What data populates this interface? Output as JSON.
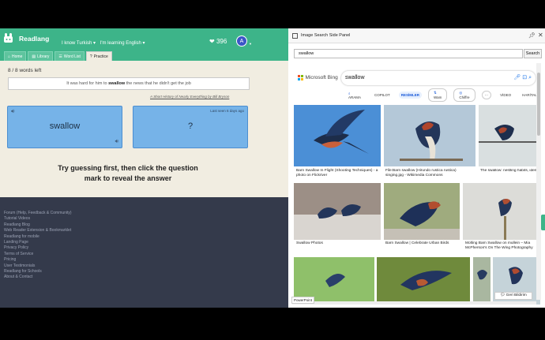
{
  "readlang": {
    "brand": "Readlang",
    "lang_known": "I know Turkish ▾",
    "lang_learning": "I'm learning English ▾",
    "points": "396",
    "avatar_letter": "A",
    "tabs": [
      {
        "label": "Home",
        "icon": "home-icon"
      },
      {
        "label": "Library",
        "icon": "library-icon"
      },
      {
        "label": "Word List",
        "icon": "list-icon"
      },
      {
        "label": "Practice",
        "icon": "question-icon"
      }
    ],
    "words_left": "8 / 8 words left",
    "sentence_before": "It was hard for him to ",
    "sentence_word": "swallow",
    "sentence_after": " the news that he didn't get the job",
    "source": "A Short History of Nearly Everything by Bill Bryson",
    "card_front_word": "swallow",
    "card_back_word": "?",
    "last_seen": "Last seen 6 days ago",
    "hint_line1": "Try guessing first, then click the question",
    "hint_line2": "mark to reveal the answer",
    "footer_links": [
      "Forum (Help, Feedback & Community)",
      "Tutorial Videos",
      "Readlang Blog",
      "Web Reader Extension & Bookmarklet",
      "Readlang for mobile",
      "Landing Page",
      "Privacy Policy",
      "Terms of Service",
      "Pricing",
      "User Testimonials",
      "Readlang for Schools",
      "About & Contact"
    ]
  },
  "side_panel": {
    "title": "Image Search Side Panel",
    "search_value": "swallow",
    "search_button": "Search",
    "bing_brand": "Microsoft Bing",
    "bing_query": "swallow",
    "bing_tabs": [
      "ARAMA",
      "COPILOT",
      "RESİMLER",
      "Wam",
      "Chiffre",
      "···",
      "VİDEO",
      "HARİTALAR"
    ],
    "results": [
      {
        "caption": "Barn Swallow In Flight (Shooting Techniques) - a photo on Flickriver"
      },
      {
        "caption": "File:Barn swallow (Hirundo rustica rustica) singing.jpg - Wikimedia Commons"
      },
      {
        "caption": "The swallow: nestling habits, identification, migration - Saga"
      },
      {
        "caption": "Swallow Photos"
      },
      {
        "caption": "Barn Swallow | Celebrate Urban Birds"
      },
      {
        "caption": "Molting Barn Swallow on mullein – Mia McPherson's On The Wing Photography"
      }
    ],
    "powerpoint_label": "PowerPoint",
    "feedback_label": "Geri Bildirim"
  },
  "colors": {
    "readlang_green": "#3db489",
    "card_blue": "#76b3e8",
    "footer_dark": "#343a4b",
    "bing_accent": "#1a5ad9"
  }
}
